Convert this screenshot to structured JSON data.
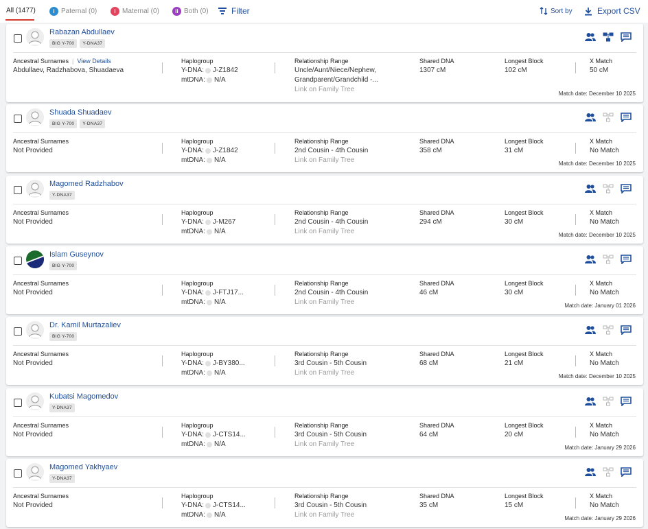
{
  "tabs": {
    "all": "All (1477)",
    "paternal": "Paternal (0)",
    "maternal": "Maternal (0)",
    "both": "Both (0)"
  },
  "toolbar": {
    "filter": "Filter",
    "sort": "Sort by",
    "export": "Export CSV"
  },
  "labels": {
    "ancestral": "Ancestral Surnames",
    "view_details": "View Details",
    "haplogroup": "Haplogroup",
    "ydna": "Y-DNA:",
    "mtdna": "mtDNA:",
    "relationship": "Relationship Range",
    "link_tree": "Link on Family Tree",
    "shared": "Shared DNA",
    "longest": "Longest Block",
    "xmatch": "X Match"
  },
  "colors": {
    "link": "#1f4f9c",
    "tab_active_underline": "#d0392b",
    "paternal_icon": "#2a8dd4",
    "maternal_icon": "#e0455d",
    "both_icon": "#9c3cc4"
  },
  "matches": [
    {
      "name": "Rabazan Abdullaev",
      "avatar": "default-avatar",
      "badges": [
        "BIG Y-700",
        "Y-DNA37"
      ],
      "surnames": "Abdullaev, Radzhabova, Shuadaeva",
      "ydna": "J-Z1842",
      "mtdna": "N/A",
      "relationship": [
        "Uncle/Aunt/Niece/Nephew,",
        "Grandparent/Grandchild -..."
      ],
      "shared": "1307 cM",
      "longest": "102 cM",
      "xmatch": "50 cM",
      "date": "Match date: December 10 2025"
    },
    {
      "name": "Shuada Shuadaev",
      "avatar": "default-avatar",
      "badges": [
        "BIG Y-700",
        "Y-DNA37"
      ],
      "surnames": "Not Provided",
      "ydna": "J-Z1842",
      "mtdna": "N/A",
      "relationship": [
        "2nd Cousin - 4th Cousin"
      ],
      "shared": "358 cM",
      "longest": "31 cM",
      "xmatch": "No Match",
      "date": "Match date: December 10 2025"
    },
    {
      "name": "Magomed Radzhabov",
      "avatar": "default-avatar",
      "badges": [
        "Y-DNA37"
      ],
      "surnames": "Not Provided",
      "ydna": "J-M267",
      "mtdna": "N/A",
      "relationship": [
        "2nd Cousin - 4th Cousin"
      ],
      "shared": "294 cM",
      "longest": "30 cM",
      "xmatch": "No Match",
      "date": "Match date: December 10 2025"
    },
    {
      "name": "Islam Guseynov",
      "avatar": "flag-avatar",
      "badges": [
        "BIG Y-700"
      ],
      "surnames": "Not Provided",
      "ydna": "J-FTJ17...",
      "mtdna": "N/A",
      "relationship": [
        "2nd Cousin - 4th Cousin"
      ],
      "shared": "46 cM",
      "longest": "30 cM",
      "xmatch": "No Match",
      "date": "Match date: January 01 2026"
    },
    {
      "name": "Dr. Kamil Murtazaliev",
      "avatar": "default-avatar",
      "badges": [
        "BIG Y-700"
      ],
      "surnames": "Not Provided",
      "ydna": "J-BY380...",
      "mtdna": "N/A",
      "relationship": [
        "3rd Cousin - 5th Cousin"
      ],
      "shared": "68 cM",
      "longest": "21 cM",
      "xmatch": "No Match",
      "date": "Match date: December 10 2025"
    },
    {
      "name": "Kubatsi Magomedov",
      "avatar": "default-avatar",
      "badges": [
        "Y-DNA37"
      ],
      "surnames": "Not Provided",
      "ydna": "J-CTS14...",
      "mtdna": "N/A",
      "relationship": [
        "3rd Cousin - 5th Cousin"
      ],
      "shared": "64 cM",
      "longest": "20 cM",
      "xmatch": "No Match",
      "date": "Match date: January 29 2026"
    },
    {
      "name": "Magomed Yakhyaev",
      "avatar": "default-avatar",
      "badges": [
        "Y-DNA37"
      ],
      "surnames": "Not Provided",
      "ydna": "J-CTS14...",
      "mtdna": "N/A",
      "relationship": [
        "3rd Cousin - 5th Cousin"
      ],
      "shared": "35 cM",
      "longest": "15 cM",
      "xmatch": "No Match",
      "date": "Match date: January 29 2026"
    }
  ]
}
